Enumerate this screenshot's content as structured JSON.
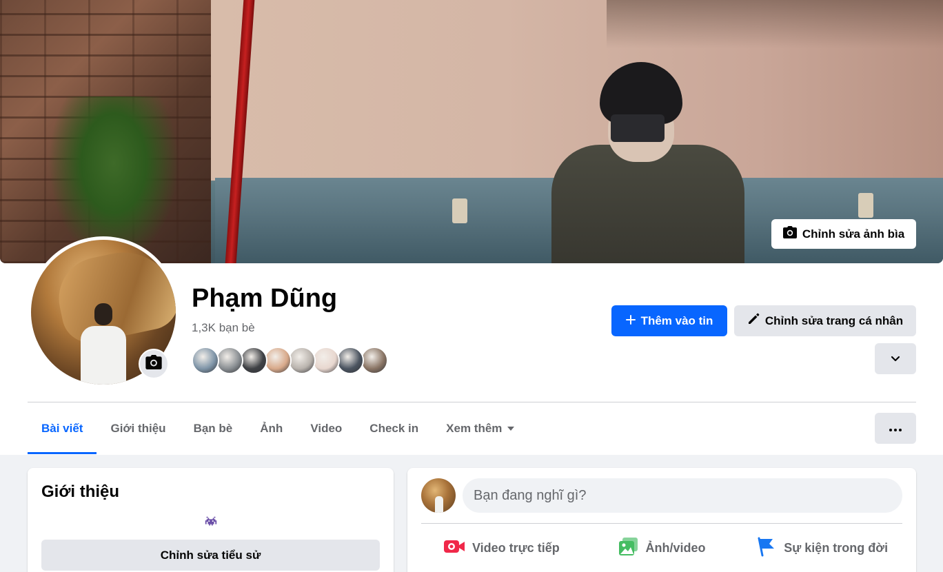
{
  "profile": {
    "name": "Phạm Dũng",
    "friend_count": "1,3K bạn bè",
    "edit_cover_label": "Chỉnh sửa ảnh bìa",
    "add_story_label": "Thêm vào tin",
    "edit_profile_label": "Chỉnh sửa trang cá nhân"
  },
  "friend_avatars": [
    {
      "color": "#7f95a8"
    },
    {
      "color": "#8a8f93"
    },
    {
      "color": "#3f4145"
    },
    {
      "color": "#d8a98a"
    },
    {
      "color": "#b9b3ad"
    },
    {
      "color": "#e8d7cf"
    },
    {
      "color": "#4b5460"
    },
    {
      "color": "#8a7565"
    }
  ],
  "tabs": [
    {
      "label": "Bài viết",
      "active": true
    },
    {
      "label": "Giới thiệu"
    },
    {
      "label": "Bạn bè"
    },
    {
      "label": "Ảnh"
    },
    {
      "label": "Video"
    },
    {
      "label": "Check in"
    },
    {
      "label": "Xem thêm"
    }
  ],
  "intro": {
    "title": "Giới thiệu",
    "edit_bio_label": "Chỉnh sửa tiểu sử"
  },
  "composer": {
    "placeholder": "Bạn đang nghĩ gì?",
    "actions": [
      {
        "label": "Video trực tiếp",
        "icon": "live-video-icon",
        "color": "#f02849"
      },
      {
        "label": "Ảnh/video",
        "icon": "photo-icon",
        "color": "#45bd62"
      },
      {
        "label": "Sự kiện trong đời",
        "icon": "flag-icon",
        "color": "#1877f2"
      }
    ]
  },
  "colors": {
    "primary": "#0866ff",
    "secondary_bg": "#e4e6eb",
    "page_bg": "#f0f2f5"
  }
}
